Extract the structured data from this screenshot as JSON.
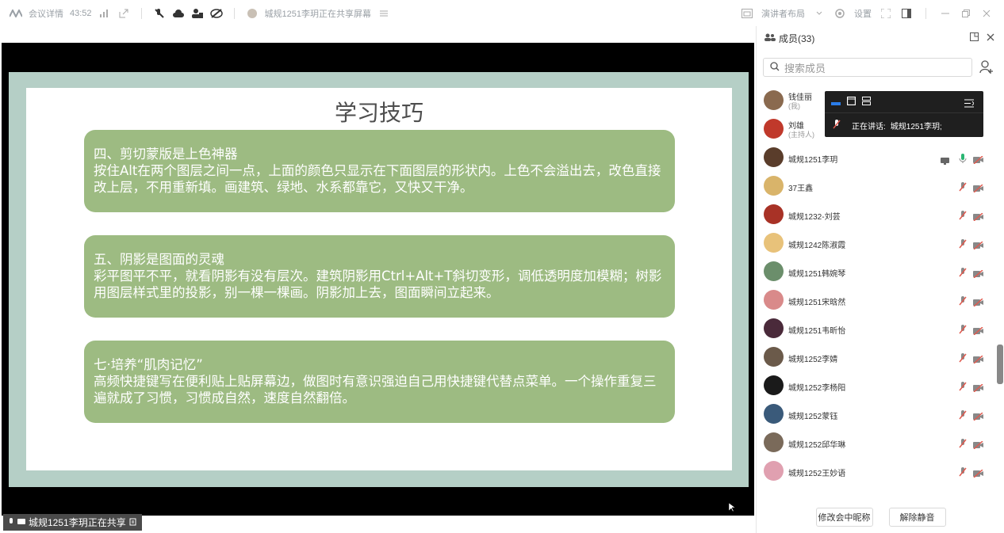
{
  "topbar": {
    "meeting_details": "会议详情",
    "timer": "43:52",
    "sharing_label": "城规1251李玥正在共享屏幕",
    "layout_label": "演讲者布局",
    "settings_label": "设置"
  },
  "slide": {
    "title": "学习技巧",
    "cards": [
      {
        "heading": "四、剪切蒙版是上色神器",
        "body": "按住Alt在两个图层之间一点，上面的颜色只显示在下面图层的形状内。上色不会溢出去，改色直接改上层，不用重新填。画建筑、绿地、水系都靠它，又快又干净。"
      },
      {
        "heading": "五、阴影是图面的灵魂",
        "body": "彩平图平不平，就看阴影有没有层次。建筑阴影用Ctrl+Alt+T斜切变形，调低透明度加模糊；树影用图层样式里的投影，别一棵一棵画。阴影加上去，图面瞬间立起来。"
      },
      {
        "heading": "七·培养“肌肉记忆”",
        "body": "高频快捷键写在便利贴上贴屏幕边，做图时有意识强迫自己用快捷键代替点菜单。一个操作重复三遍就成了习惯，习惯成自然，速度自然翻倍。"
      }
    ]
  },
  "status": {
    "sharing_text": "城规1251李玥正在共享"
  },
  "panel": {
    "title": "成员(33)",
    "search_placeholder": "搜索成员",
    "members": [
      {
        "name": "钱佳丽",
        "sub": "(我)",
        "avatar_color": "#8a6a4f"
      },
      {
        "name": "刘雄",
        "sub": "(主持人)",
        "avatar_color": "#c0392b"
      },
      {
        "name": "城规1251李玥",
        "sub": "",
        "avatar_color": "#5a3d2b"
      },
      {
        "name": "37王鑫",
        "sub": "",
        "avatar_color": "#d9b46a"
      },
      {
        "name": "城规1232-刘芸",
        "sub": "",
        "avatar_color": "#a83226"
      },
      {
        "name": "城规1242陈淑霞",
        "sub": "",
        "avatar_color": "#e8c27a"
      },
      {
        "name": "城规1251韩婉琴",
        "sub": "",
        "avatar_color": "#6b8e6b"
      },
      {
        "name": "城规1251宋晗然",
        "sub": "",
        "avatar_color": "#d98a8a"
      },
      {
        "name": "城规1251韦昕怡",
        "sub": "",
        "avatar_color": "#4a2a3a"
      },
      {
        "name": "城规1252李婧",
        "sub": "",
        "avatar_color": "#6b5a4a"
      },
      {
        "name": "城规1252李杨阳",
        "sub": "",
        "avatar_color": "#1a1a1a"
      },
      {
        "name": "城规1252蒙钰",
        "sub": "",
        "avatar_color": "#3a5a7a"
      },
      {
        "name": "城规1252邱华琳",
        "sub": "",
        "avatar_color": "#7a6a5a"
      },
      {
        "name": "城规1252王妙语",
        "sub": "",
        "avatar_color": "#e0a0b0"
      }
    ],
    "footer": {
      "rename_label": "修改会中昵称",
      "unmute_label": "解除静音"
    }
  },
  "popover": {
    "speaking_label": "正在讲话:",
    "speaker": "城规1251李玥;"
  },
  "colors": {
    "card_green": "#9dbb82",
    "slide_frame": "#b5cfc6",
    "mute_red": "#e05a4f"
  }
}
